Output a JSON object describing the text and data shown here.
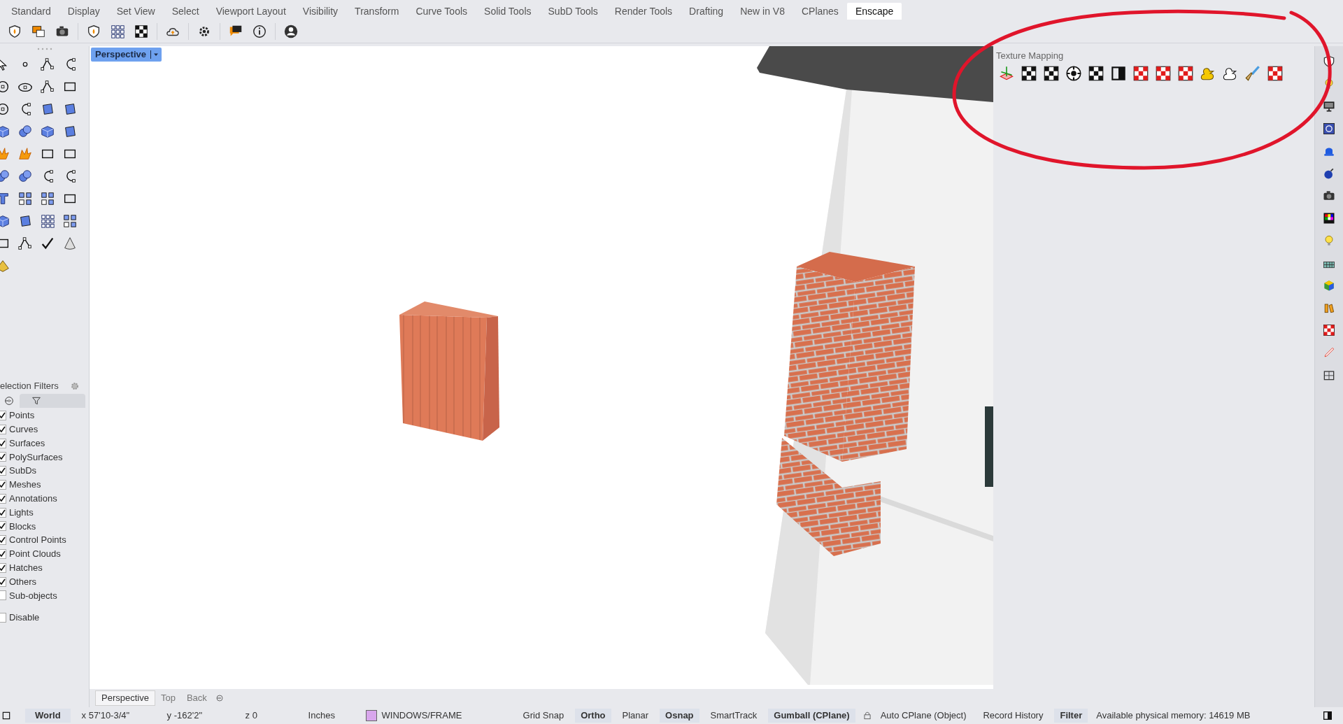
{
  "menu_tabs": [
    {
      "label": "Standard",
      "selected": false
    },
    {
      "label": "Display",
      "selected": false
    },
    {
      "label": "Set View",
      "selected": false
    },
    {
      "label": "Select",
      "selected": false
    },
    {
      "label": "Viewport Layout",
      "selected": false
    },
    {
      "label": "Visibility",
      "selected": false
    },
    {
      "label": "Transform",
      "selected": false
    },
    {
      "label": "Curve Tools",
      "selected": false
    },
    {
      "label": "Solid Tools",
      "selected": false
    },
    {
      "label": "SubD Tools",
      "selected": false
    },
    {
      "label": "Render Tools",
      "selected": false
    },
    {
      "label": "Drafting",
      "selected": false
    },
    {
      "label": "New in V8",
      "selected": false
    },
    {
      "label": "CPlanes",
      "selected": false
    },
    {
      "label": "Enscape",
      "selected": true
    }
  ],
  "viewport": {
    "title": "Perspective",
    "tabs": [
      {
        "label": "Perspective",
        "selected": true
      },
      {
        "label": "Top",
        "selected": false
      },
      {
        "label": "Back",
        "selected": false
      }
    ]
  },
  "selection_filters": {
    "title": "election Filters",
    "items": [
      {
        "label": "Points",
        "checked": true
      },
      {
        "label": "Curves",
        "checked": true
      },
      {
        "label": "Surfaces",
        "checked": true
      },
      {
        "label": "PolySurfaces",
        "checked": true
      },
      {
        "label": "SubDs",
        "checked": true
      },
      {
        "label": "Meshes",
        "checked": true
      },
      {
        "label": "Annotations",
        "checked": true
      },
      {
        "label": "Lights",
        "checked": true
      },
      {
        "label": "Blocks",
        "checked": true
      },
      {
        "label": "Control Points",
        "checked": true
      },
      {
        "label": "Point Clouds",
        "checked": true
      },
      {
        "label": "Hatches",
        "checked": true
      },
      {
        "label": "Others",
        "checked": true
      },
      {
        "label": "Sub-objects",
        "checked": false
      }
    ],
    "disable": {
      "label": "Disable",
      "checked": false
    }
  },
  "texture_mapping": {
    "title": "Texture Mapping"
  },
  "status_bar": {
    "cplane": "World",
    "x": "x 57'10-3/4\"",
    "y": "y -162'2\"",
    "z": "z 0",
    "units": "Inches",
    "layer": {
      "name": "WINDOWS/FRAME",
      "color": "#d8a6ec"
    },
    "toggles": [
      {
        "label": "Grid Snap",
        "on": false,
        "kind": "toggle"
      },
      {
        "label": "Ortho",
        "on": true,
        "kind": "toggle"
      },
      {
        "label": "Planar",
        "on": false,
        "kind": "toggle"
      },
      {
        "label": "Osnap",
        "on": true,
        "kind": "toggle"
      },
      {
        "label": "SmartTrack",
        "on": false,
        "kind": "toggle"
      },
      {
        "label": "Gumball (CPlane)",
        "on": true,
        "kind": "toggle"
      },
      {
        "label": "Auto CPlane (Object)",
        "on": false,
        "kind": "locked"
      },
      {
        "label": "Record History",
        "on": false,
        "kind": "toggle"
      },
      {
        "label": "Filter",
        "on": true,
        "kind": "toggle"
      }
    ],
    "memory": "Available physical memory: 14619 MB"
  }
}
